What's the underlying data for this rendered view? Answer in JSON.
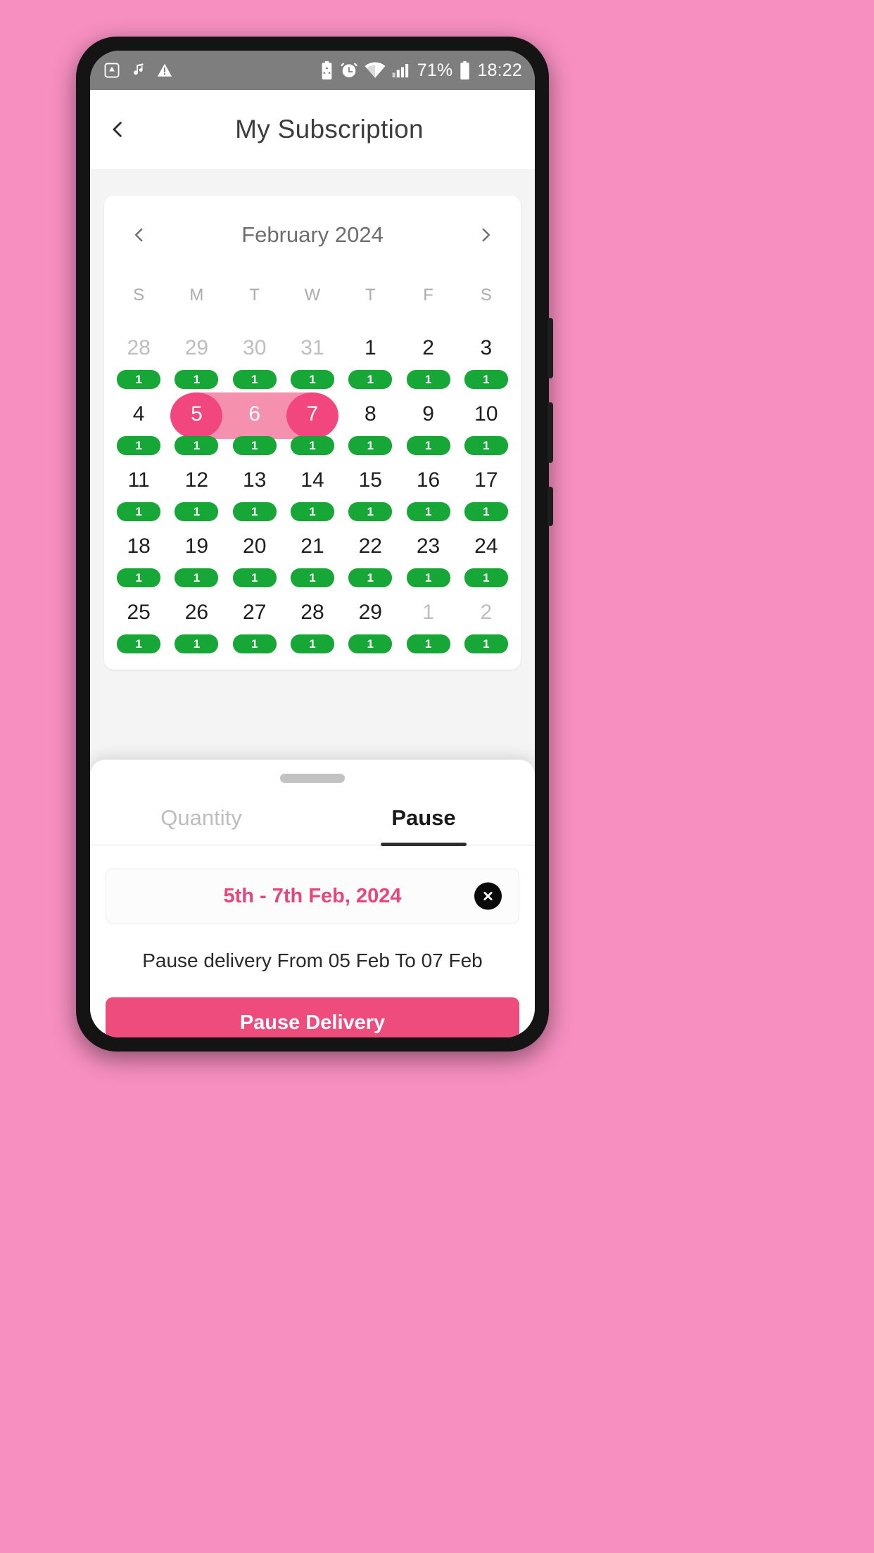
{
  "status_bar": {
    "left_icons": [
      "triangle-drop-icon",
      "music-note-icon",
      "warning-icon"
    ],
    "right_icons": [
      "battery-saver-icon",
      "alarm-icon",
      "wifi-icon",
      "signal-icon"
    ],
    "battery_text": "71%",
    "time_text": "18:22"
  },
  "header": {
    "back_icon": "chevron-left-icon",
    "title": "My Subscription"
  },
  "calendar": {
    "prev_icon": "chevron-left-icon",
    "next_icon": "chevron-right-icon",
    "month_label": "February 2024",
    "weekdays": [
      "S",
      "M",
      "T",
      "W",
      "T",
      "F",
      "S"
    ],
    "weeks": [
      [
        {
          "day": "28",
          "muted": true,
          "qty": "1"
        },
        {
          "day": "29",
          "muted": true,
          "qty": "1"
        },
        {
          "day": "30",
          "muted": true,
          "qty": "1"
        },
        {
          "day": "31",
          "muted": true,
          "qty": "1"
        },
        {
          "day": "1",
          "muted": false,
          "qty": "1"
        },
        {
          "day": "2",
          "muted": false,
          "qty": "1"
        },
        {
          "day": "3",
          "muted": false,
          "qty": "1"
        }
      ],
      [
        {
          "day": "4",
          "muted": false,
          "qty": "1"
        },
        {
          "day": "5",
          "muted": false,
          "qty": "1",
          "sel": "start"
        },
        {
          "day": "6",
          "muted": false,
          "qty": "1",
          "sel": "mid"
        },
        {
          "day": "7",
          "muted": false,
          "qty": "1",
          "sel": "end"
        },
        {
          "day": "8",
          "muted": false,
          "qty": "1"
        },
        {
          "day": "9",
          "muted": false,
          "qty": "1"
        },
        {
          "day": "10",
          "muted": false,
          "qty": "1"
        }
      ],
      [
        {
          "day": "11",
          "muted": false,
          "qty": "1"
        },
        {
          "day": "12",
          "muted": false,
          "qty": "1"
        },
        {
          "day": "13",
          "muted": false,
          "qty": "1"
        },
        {
          "day": "14",
          "muted": false,
          "qty": "1"
        },
        {
          "day": "15",
          "muted": false,
          "qty": "1"
        },
        {
          "day": "16",
          "muted": false,
          "qty": "1"
        },
        {
          "day": "17",
          "muted": false,
          "qty": "1"
        }
      ],
      [
        {
          "day": "18",
          "muted": false,
          "qty": "1"
        },
        {
          "day": "19",
          "muted": false,
          "qty": "1"
        },
        {
          "day": "20",
          "muted": false,
          "qty": "1"
        },
        {
          "day": "21",
          "muted": false,
          "qty": "1"
        },
        {
          "day": "22",
          "muted": false,
          "qty": "1"
        },
        {
          "day": "23",
          "muted": false,
          "qty": "1"
        },
        {
          "day": "24",
          "muted": false,
          "qty": "1"
        }
      ],
      [
        {
          "day": "25",
          "muted": false,
          "qty": "1"
        },
        {
          "day": "26",
          "muted": false,
          "qty": "1"
        },
        {
          "day": "27",
          "muted": false,
          "qty": "1"
        },
        {
          "day": "28",
          "muted": false,
          "qty": "1"
        },
        {
          "day": "29",
          "muted": false,
          "qty": "1"
        },
        {
          "day": "1",
          "muted": true,
          "qty": "1"
        },
        {
          "day": "2",
          "muted": true,
          "qty": "1"
        }
      ]
    ]
  },
  "sheet": {
    "handle": "drag-handle",
    "tabs": [
      {
        "label": "Quantity",
        "active": false
      },
      {
        "label": "Pause",
        "active": true
      }
    ],
    "range_label": "5th - 7th Feb, 2024",
    "clear_icon": "close-icon",
    "info_text": "Pause delivery From 05 Feb To 07 Feb",
    "primary_button": "Pause Delivery"
  },
  "colors": {
    "accent_pink": "#EF4C7E",
    "range_fill": "#F690AF",
    "range_edge": "#F2477E",
    "qty_green": "#17A736",
    "page_bg": "#F78FC0",
    "status_bar": "#7E7E7E"
  }
}
